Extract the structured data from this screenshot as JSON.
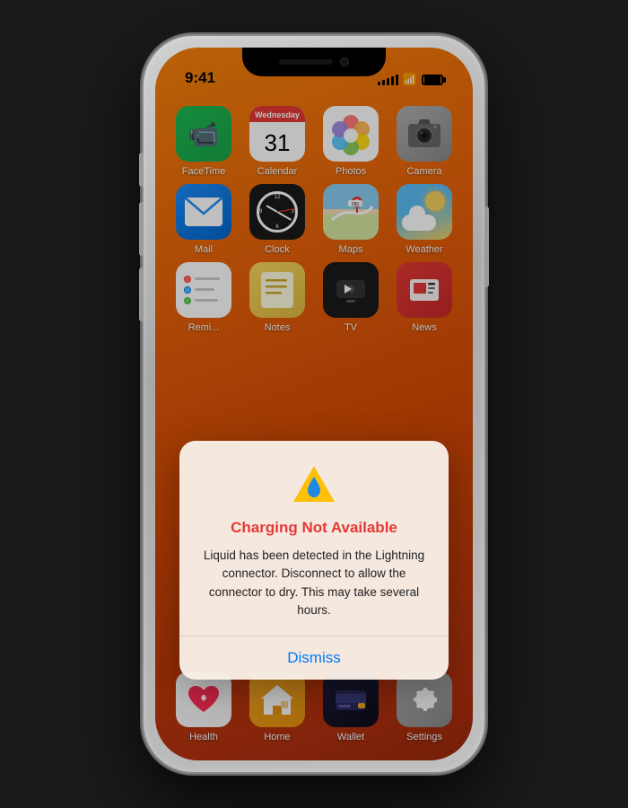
{
  "phone": {
    "status_bar": {
      "time": "9:41",
      "signal_bars": [
        4,
        6,
        8,
        10,
        12
      ],
      "wifi": "wifi",
      "battery": "battery"
    },
    "app_rows": [
      [
        {
          "id": "facetime",
          "label": "FaceTime",
          "icon_type": "facetime"
        },
        {
          "id": "calendar",
          "label": "Calendar",
          "icon_type": "calendar",
          "cal_day": "Wednesday",
          "cal_date": "31"
        },
        {
          "id": "photos",
          "label": "Photos",
          "icon_type": "photos"
        },
        {
          "id": "camera",
          "label": "Camera",
          "icon_type": "camera"
        }
      ],
      [
        {
          "id": "mail",
          "label": "Mail",
          "icon_type": "mail"
        },
        {
          "id": "clock",
          "label": "Clock",
          "icon_type": "clock"
        },
        {
          "id": "maps",
          "label": "Maps",
          "icon_type": "maps"
        },
        {
          "id": "weather",
          "label": "Weather",
          "icon_type": "weather"
        }
      ],
      [
        {
          "id": "reminders",
          "label": "Remi...",
          "icon_type": "reminders"
        },
        {
          "id": "notes",
          "label": "Notes",
          "icon_type": "notes"
        },
        {
          "id": "appletv",
          "label": "...",
          "icon_type": "appletv"
        },
        {
          "id": "news",
          "label": "...ws",
          "icon_type": "news"
        }
      ]
    ],
    "dock": [
      {
        "id": "health",
        "label": "Health",
        "icon_type": "health"
      },
      {
        "id": "home",
        "label": "Home",
        "icon_type": "home"
      },
      {
        "id": "wallet",
        "label": "Wallet",
        "icon_type": "wallet"
      },
      {
        "id": "settings",
        "label": "Settings",
        "icon_type": "settings"
      }
    ]
  },
  "alert": {
    "title": "Charging Not Available",
    "message": "Liquid has been detected in the Lightning connector. Disconnect to allow the connector to dry. This may take several hours.",
    "dismiss_label": "Dismiss",
    "icon": "⚠️"
  }
}
